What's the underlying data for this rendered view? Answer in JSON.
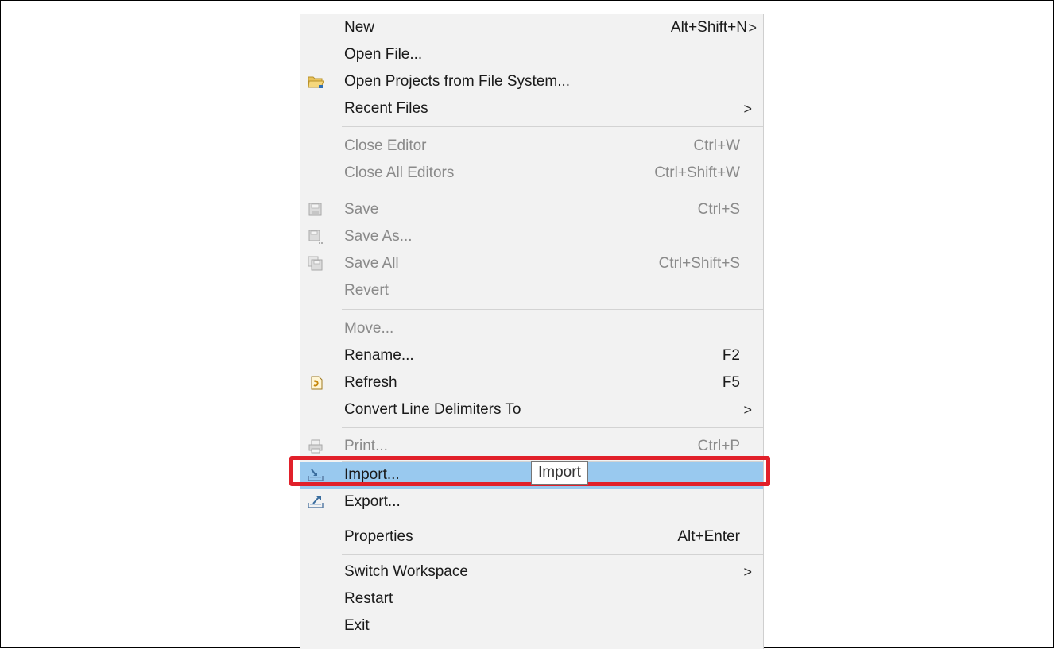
{
  "colors": {
    "highlight": "#99c9ef",
    "callout_border": "#e1202a",
    "disabled_text": "#8a8a8a",
    "menu_background": "#f2f2f2"
  },
  "menu": {
    "new": {
      "label": "New",
      "shortcut": "Alt+Shift+N",
      "submenu": true
    },
    "open_file": {
      "label": "Open File..."
    },
    "open_projects": {
      "label": "Open Projects from File System...",
      "icon": "folder-icon"
    },
    "recent_files": {
      "label": "Recent Files",
      "submenu": true
    },
    "close_editor": {
      "label": "Close Editor",
      "shortcut": "Ctrl+W",
      "disabled": true
    },
    "close_all_editors": {
      "label": "Close All Editors",
      "shortcut": "Ctrl+Shift+W",
      "disabled": true
    },
    "save": {
      "label": "Save",
      "shortcut": "Ctrl+S",
      "disabled": true,
      "icon": "save-icon"
    },
    "save_as": {
      "label": "Save As...",
      "disabled": true,
      "icon": "save-as-icon"
    },
    "save_all": {
      "label": "Save All",
      "shortcut": "Ctrl+Shift+S",
      "disabled": true,
      "icon": "save-all-icon"
    },
    "revert": {
      "label": "Revert",
      "disabled": true
    },
    "move": {
      "label": "Move...",
      "disabled": true
    },
    "rename": {
      "label": "Rename...",
      "shortcut": "F2"
    },
    "refresh": {
      "label": "Refresh",
      "shortcut": "F5",
      "icon": "refresh-icon"
    },
    "convert_line_delimiters": {
      "label": "Convert Line Delimiters To",
      "submenu": true
    },
    "print": {
      "label": "Print...",
      "shortcut": "Ctrl+P",
      "disabled": true,
      "icon": "print-icon"
    },
    "import": {
      "label": "Import...",
      "highlighted": true,
      "icon": "import-icon"
    },
    "export": {
      "label": "Export...",
      "icon": "export-icon"
    },
    "properties": {
      "label": "Properties",
      "shortcut": "Alt+Enter"
    },
    "switch_workspace": {
      "label": "Switch Workspace",
      "submenu": true
    },
    "restart": {
      "label": "Restart"
    },
    "exit": {
      "label": "Exit"
    },
    "submenu_arrow": ">"
  },
  "tooltip": {
    "text": "Import"
  }
}
